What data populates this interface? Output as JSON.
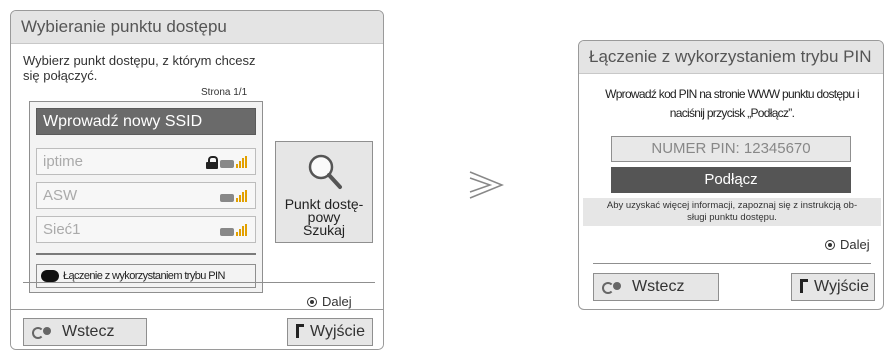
{
  "left_panel": {
    "title": "Wybieranie punktu dostępu",
    "instruction": "Wybierz punkt dostępu, z którym chcesz się połączyć.",
    "page_indicator": "Strona 1/1",
    "new_ssid_label": "Wprowadź nowy SSID",
    "networks": [
      {
        "name": "iptime",
        "locked": true,
        "icon": "router-signal-icon"
      },
      {
        "name": "ASW",
        "locked": false,
        "icon": "router-signal-icon"
      },
      {
        "name": "Sieć1",
        "locked": false,
        "icon": "router-signal-icon"
      }
    ],
    "pin_connect_label": "Łączenie z wykorzystaniem trybu PIN",
    "search_button_label_1": "Punkt dostę-",
    "search_button_label_2": "powy",
    "search_button_label_3": "Szukaj",
    "next_label": "Dalej",
    "back_label": "Wstecz",
    "exit_label": "Wyjście"
  },
  "right_panel": {
    "title": "Łączenie z wykorzystaniem trybu PIN",
    "instruction_line1": "Wprowadź kod PIN na stronie WWW punktu dostępu i",
    "instruction_line2": "naciśnij przycisk „Podłącz”.",
    "pin_label": "NUMER PIN: 12345670",
    "connect_label": "Podłącz",
    "info_line1": "Aby uzyskać więcej informacji, zapoznaj się z instrukcją ob-",
    "info_line2": "sługi punktu dostępu.",
    "next_label": "Dalej",
    "back_label": "Wstecz",
    "exit_label": "Wyjście"
  },
  "colors": {
    "selected_bg": "#6a6a6a",
    "title_bg": "#e4e4e4",
    "signal": "#e2a000",
    "connect_bg": "#555555"
  }
}
